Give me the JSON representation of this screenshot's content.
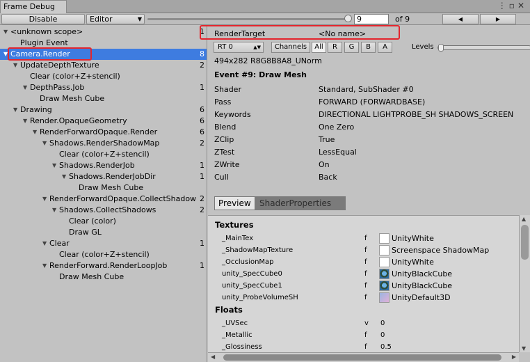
{
  "window": {
    "title": "Frame Debug"
  },
  "toolbar": {
    "disable_label": "Disable",
    "editor_label": "Editor",
    "frame_value": "9",
    "of_label": "of 9",
    "prev_icon": "◀",
    "next_icon": "▶"
  },
  "tree": [
    {
      "label": "<unknown scope>",
      "count": "1",
      "depth": 0,
      "expanded": true
    },
    {
      "label": "Plugin Event",
      "count": "",
      "depth": 1,
      "expanded": null
    },
    {
      "label": "Camera.Render",
      "count": "8",
      "depth": 0,
      "expanded": true,
      "selected": true
    },
    {
      "label": "UpdateDepthTexture",
      "count": "2",
      "depth": 1,
      "expanded": true
    },
    {
      "label": "Clear (color+Z+stencil)",
      "count": "",
      "depth": 2,
      "expanded": null
    },
    {
      "label": "DepthPass.Job",
      "count": "1",
      "depth": 2,
      "expanded": true
    },
    {
      "label": "Draw Mesh Cube",
      "count": "",
      "depth": 3,
      "expanded": null
    },
    {
      "label": "Drawing",
      "count": "6",
      "depth": 1,
      "expanded": true
    },
    {
      "label": "Render.OpaqueGeometry",
      "count": "6",
      "depth": 2,
      "expanded": true
    },
    {
      "label": "RenderForwardOpaque.Render",
      "count": "6",
      "depth": 3,
      "expanded": true
    },
    {
      "label": "Shadows.RenderShadowMap",
      "count": "2",
      "depth": 4,
      "expanded": true
    },
    {
      "label": "Clear (color+Z+stencil)",
      "count": "",
      "depth": 5,
      "expanded": null
    },
    {
      "label": "Shadows.RenderJob",
      "count": "1",
      "depth": 5,
      "expanded": true
    },
    {
      "label": "Shadows.RenderJobDir",
      "count": "1",
      "depth": 6,
      "expanded": true
    },
    {
      "label": "Draw Mesh Cube",
      "count": "",
      "depth": 7,
      "expanded": null
    },
    {
      "label": "RenderForwardOpaque.CollectShadow",
      "count": "2",
      "depth": 4,
      "expanded": true
    },
    {
      "label": "Shadows.CollectShadows",
      "count": "2",
      "depth": 5,
      "expanded": true
    },
    {
      "label": "Clear (color)",
      "count": "",
      "depth": 6,
      "expanded": null
    },
    {
      "label": "Draw GL",
      "count": "",
      "depth": 6,
      "expanded": null
    },
    {
      "label": "Clear",
      "count": "1",
      "depth": 4,
      "expanded": true
    },
    {
      "label": "Clear (color+Z+stencil)",
      "count": "",
      "depth": 5,
      "expanded": null
    },
    {
      "label": "RenderForward.RenderLoopJob",
      "count": "1",
      "depth": 4,
      "expanded": true
    },
    {
      "label": "Draw Mesh Cube",
      "count": "",
      "depth": 5,
      "expanded": null
    }
  ],
  "render_target": {
    "label": "RenderTarget",
    "value": "<No name>"
  },
  "channels": {
    "rt_label": "RT 0",
    "channels_label": "Channels",
    "all": "All",
    "r": "R",
    "g": "G",
    "b": "B",
    "a": "A",
    "levels_label": "Levels"
  },
  "format": "494x282 R8G8B8A8_UNorm",
  "event_title": "Event #9: Draw Mesh",
  "details": [
    {
      "k": "Shader",
      "v": "Standard, SubShader #0"
    },
    {
      "k": "Pass",
      "v": "FORWARD (FORWARDBASE)"
    },
    {
      "k": "Keywords",
      "v": "DIRECTIONAL LIGHTPROBE_SH SHADOWS_SCREEN"
    },
    {
      "k": "Blend",
      "v": "One Zero"
    },
    {
      "k": "ZClip",
      "v": "True"
    },
    {
      "k": "ZTest",
      "v": "LessEqual"
    },
    {
      "k": "ZWrite",
      "v": "On"
    },
    {
      "k": "Cull",
      "v": "Back"
    }
  ],
  "tabs": {
    "preview": "Preview",
    "shader_properties": "ShaderProperties"
  },
  "textures_header": "Textures",
  "textures": [
    {
      "name": "_MainTex",
      "flag": "f",
      "tex": "UnityWhite",
      "icon": "white"
    },
    {
      "name": "_ShadowMapTexture",
      "flag": "f",
      "tex": "Screenspace ShadowMap",
      "icon": "white"
    },
    {
      "name": "_OcclusionMap",
      "flag": "f",
      "tex": "UnityWhite",
      "icon": "white"
    },
    {
      "name": "unity_SpecCube0",
      "flag": "f",
      "tex": "UnityBlackCube",
      "icon": "cube"
    },
    {
      "name": "unity_SpecCube1",
      "flag": "f",
      "tex": "UnityBlackCube",
      "icon": "cube"
    },
    {
      "name": "unity_ProbeVolumeSH",
      "flag": "f",
      "tex": "UnityDefault3D",
      "icon": "d3"
    }
  ],
  "floats_header": "Floats",
  "floats": [
    {
      "name": "_UVSec",
      "flag": "v",
      "value": "0"
    },
    {
      "name": "_Metallic",
      "flag": "f",
      "value": "0"
    },
    {
      "name": "_Glossiness",
      "flag": "f",
      "value": "0.5"
    }
  ],
  "highlight_color": "#e3262e",
  "selection_color": "#3e7ce0"
}
